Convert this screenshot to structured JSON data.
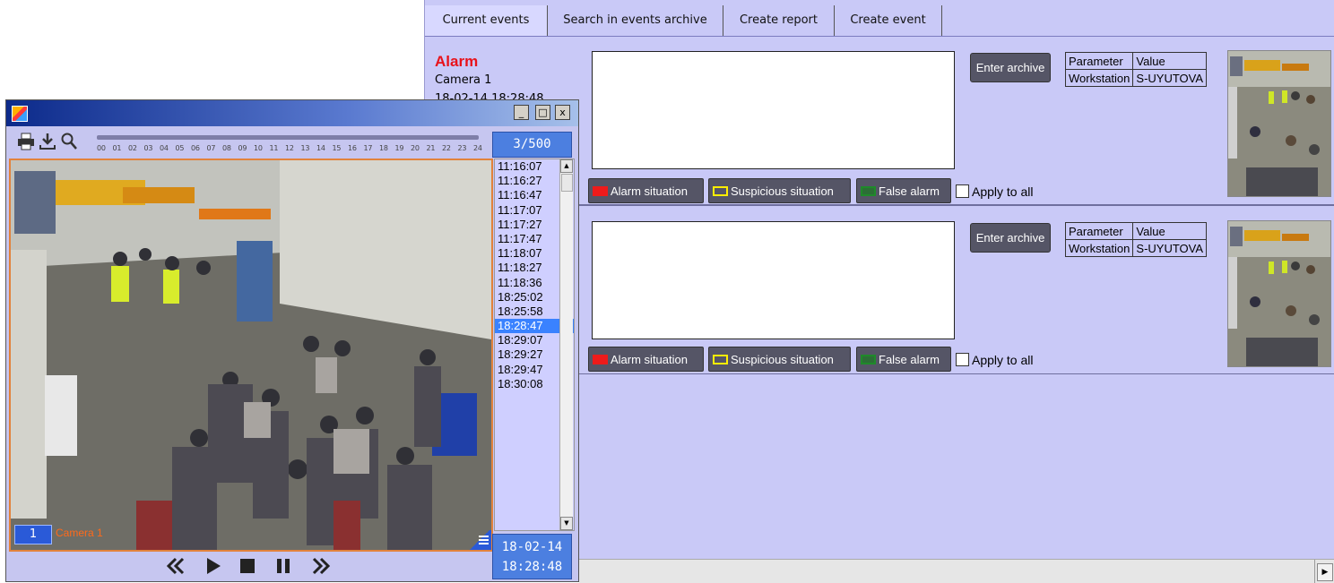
{
  "tabs": [
    "Current events",
    "Search in events archive",
    "Create report",
    "Create event"
  ],
  "events": [
    {
      "title": "Alarm",
      "camera": "Camera 1",
      "time": "18-02-14 18:28:48",
      "enter_archive": "Enter archive",
      "param_header": [
        "Parameter",
        "Value"
      ],
      "param_rows": [
        [
          "Workstation",
          "S-UYUTOVA"
        ]
      ],
      "buttons": [
        "Alarm situation",
        "Suspicious situation",
        "False alarm"
      ],
      "apply_all": "Apply to all"
    },
    {
      "enter_archive": "Enter archive",
      "param_header": [
        "Parameter",
        "Value"
      ],
      "param_rows": [
        [
          "Workstation",
          "S-UYUTOVA"
        ]
      ],
      "buttons": [
        "Alarm situation",
        "Suspicious situation",
        "False alarm"
      ],
      "apply_all": "Apply to all"
    }
  ],
  "colors": {
    "alarm": "#ee1b1b",
    "suspicious": "#ffee00",
    "false_alarm": "#1f8a2a",
    "window_bg": "#c9c9f7",
    "accent": "#4c7fe0"
  },
  "video": {
    "window_buttons": [
      "_",
      "□",
      "x"
    ],
    "timeline_ticks": [
      "00",
      "01",
      "02",
      "03",
      "04",
      "05",
      "06",
      "07",
      "08",
      "09",
      "10",
      "11",
      "12",
      "13",
      "14",
      "15",
      "16",
      "17",
      "18",
      "19",
      "20",
      "21",
      "22",
      "23",
      "24"
    ],
    "frame_counter": "3/500",
    "camera_number": "1",
    "camera_name": "Camera 1",
    "times": [
      "11:16:07",
      "11:16:27",
      "11:16:47",
      "11:17:07",
      "11:17:27",
      "11:17:47",
      "11:18:07",
      "11:18:27",
      "11:18:36",
      "18:25:02",
      "18:25:58",
      "18:28:47",
      "18:29:07",
      "18:29:27",
      "18:29:47",
      "18:30:08"
    ],
    "selected_time": "18:28:47",
    "date": "18-02-14",
    "time": "18:28:48",
    "icons": [
      "print-icon",
      "download-icon",
      "zoom-icon",
      "rewind-icon",
      "play-icon",
      "stop-icon",
      "pause-icon",
      "fast-forward-icon",
      "menu-icon"
    ]
  }
}
